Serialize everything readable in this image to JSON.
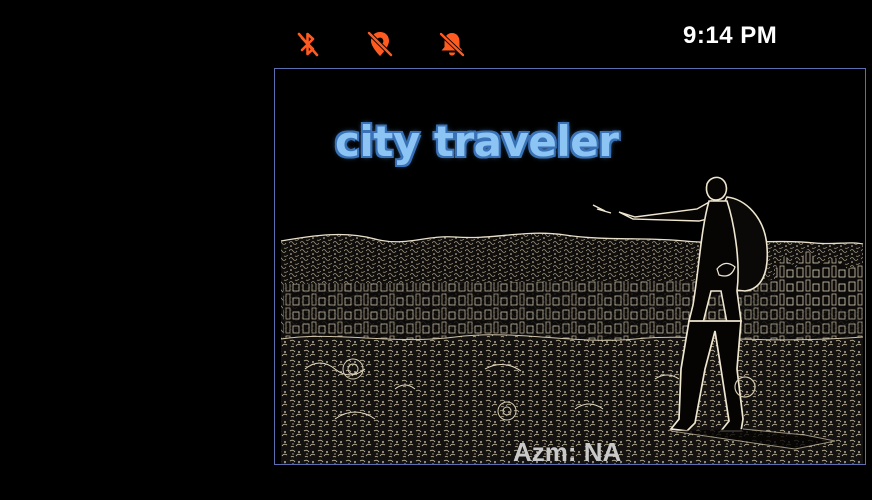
{
  "status_bar": {
    "time": "9:14 PM",
    "icons": [
      "bluetooth-off-icon",
      "location-off-icon",
      "notifications-off-icon"
    ],
    "icon_color": "#ff5a1f"
  },
  "app": {
    "title": "city traveler",
    "title_color": "#8cc4f4",
    "azimuth_label": "Azm: NA",
    "frame_color": "#5a6fb0"
  }
}
